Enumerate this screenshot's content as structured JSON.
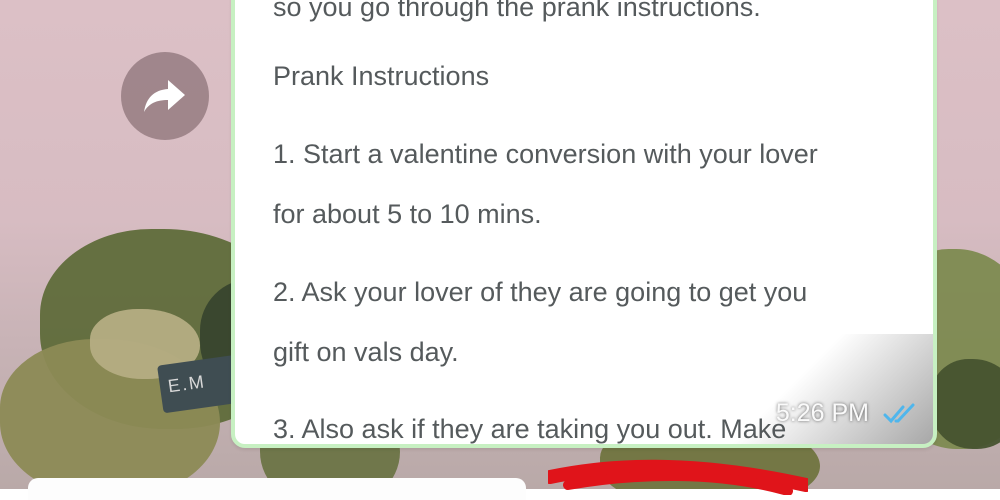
{
  "message": {
    "top_line": "so you go through the prank instructions.",
    "heading": "Prank Instructions",
    "lines": [
      "1. Start a valentine conversion with your lover",
      "for about 5 to 10 mins.",
      "2. Ask your lover of they are going to get you",
      "gift on vals day.",
      "3. Also ask if they are taking you out. Make"
    ],
    "time": "5:26 PM",
    "status_icon": "double-check-icon"
  },
  "colors": {
    "bubble_border": "#c7f0c2",
    "text": "#555a5c",
    "read_ticks": "#4fb6ec",
    "annotation": "#e0141a"
  }
}
